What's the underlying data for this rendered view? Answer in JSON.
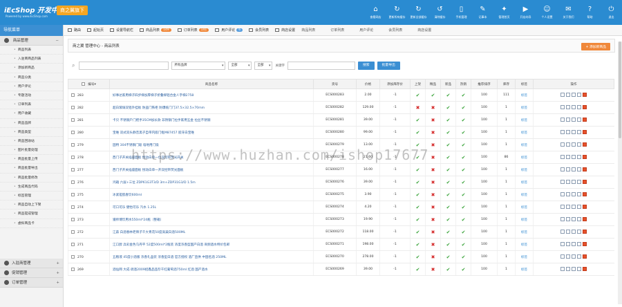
{
  "header": {
    "logo": "iEcShop 开发中心",
    "logo_sub": "Powered by www.iEcShop.com",
    "badge": "商之翼旗下",
    "nav": [
      {
        "label": "查看网店",
        "icon": "home-icon",
        "glyph": "⌂"
      },
      {
        "label": "更新所有缓存",
        "icon": "refresh-icon",
        "glyph": "↻"
      },
      {
        "label": "更新全部缓存",
        "icon": "refresh-icon",
        "glyph": "↻"
      },
      {
        "label": "清除缓存",
        "icon": "clear-icon",
        "glyph": "↺"
      },
      {
        "label": "手机管理",
        "icon": "phone-icon",
        "glyph": "▯"
      },
      {
        "label": "记事本",
        "icon": "notepad-icon",
        "glyph": "✎"
      },
      {
        "label": "管理首页",
        "icon": "manage-icon",
        "glyph": "✦"
      },
      {
        "label": "开店向导",
        "icon": "guide-icon",
        "glyph": "▶"
      },
      {
        "label": "个人设置",
        "icon": "user-icon",
        "glyph": "☺"
      },
      {
        "label": "关于我们",
        "icon": "about-icon",
        "glyph": "✉"
      },
      {
        "label": "帮助",
        "icon": "help-icon",
        "glyph": "?"
      },
      {
        "label": "退出",
        "icon": "power-icon",
        "glyph": "⏻"
      }
    ]
  },
  "sidebar": {
    "title": "导航菜单",
    "group": "商品管理",
    "items": [
      "商品列表",
      "入驻商商品列表",
      "添加新商品",
      "商品分类",
      "用户评论",
      "专题活动",
      "订单列表",
      "用户收藏",
      "商品品牌",
      "商品类型",
      "商品回收站",
      "图片批量处理",
      "商品批量上传",
      "商品批量导出",
      "商品批量修改",
      "生成商品代码",
      "标签管理",
      "商品自动上下架",
      "商品提成管理",
      "虚拟商品卡"
    ],
    "bottom_groups": [
      "入驻商管理",
      "促销管理",
      "订单管理"
    ]
  },
  "tabs": [
    {
      "label": "路由",
      "badge": ""
    },
    {
      "label": "起始页",
      "badge": ""
    },
    {
      "label": "设置导航栏",
      "badge": ""
    },
    {
      "label": "商品列表",
      "badge": "149"
    },
    {
      "label": "订单列表",
      "badge": "141"
    },
    {
      "label": "用户评论",
      "badge": "6"
    },
    {
      "label": "会员列表",
      "badge": ""
    },
    {
      "label": "商店设置",
      "badge": ""
    }
  ],
  "tabs_plain": [
    "商品列表",
    "订单列表",
    "用户评论",
    "会员列表",
    "商店设置"
  ],
  "panel": {
    "breadcrumb": "商之翼 管理中心 - 商品列表",
    "add_button": "+ 添加新商品"
  },
  "search": {
    "category": "所有品牌",
    "all1": "全部",
    "all2": "全部",
    "keyword_label": "关键字",
    "search_btn": "搜索",
    "export_btn": "批量导出"
  },
  "table": {
    "headers": [
      "编号▾",
      "商品名称",
      "货号",
      "价格",
      "添加库存价",
      "上架",
      "精品",
      "新品",
      "热销",
      "推荐排序",
      "库存",
      "标签",
      "操作"
    ],
    "rows": [
      {
        "id": "283",
        "name": "好事达家用梯子四步梯加厚梯子折叠梯铝合金人字梯2758",
        "sn": "ECS000283",
        "price": "2.00",
        "st": "-1",
        "flags": [
          "ok",
          "ok",
          "ok",
          "ok"
        ],
        "sort": "100",
        "stock": "111",
        "tag": "标签"
      },
      {
        "id": "282",
        "name": "超白玻璃双铝外挂板 防盗门铁柜 防爆纸门门37.5×32.5×70mm",
        "sn": "ECS000282",
        "price": "129.00",
        "st": "-1",
        "flags": [
          "no",
          "no",
          "ok",
          "ok"
        ],
        "sort": "100",
        "stock": "1",
        "tag": "标签"
      },
      {
        "id": "281",
        "name": "卡贝 不锈钢户门把手35CM加长款 非锈钢门拉手家用五金 拉丝不锈钢",
        "sn": "ECS000281",
        "price": "39.00",
        "st": "-1",
        "flags": [
          "ok",
          "no",
          "ok",
          "ok"
        ],
        "sort": "100",
        "stock": "1",
        "tag": "标签"
      },
      {
        "id": "280",
        "name": "宝唯 双式双头静音黑子自带内嵌门框M87457 嵌牙白宝唯",
        "sn": "ECS000280",
        "price": "99.00",
        "st": "-1",
        "flags": [
          "ok",
          "no",
          "ok",
          "ok"
        ],
        "sort": "100",
        "stock": "1",
        "tag": "标签"
      },
      {
        "id": "279",
        "name": "固特 304不锈钢门吸 墙地用门吸",
        "sn": "ECS000279",
        "price": "13.00",
        "st": "-1",
        "flags": [
          "ok",
          "no",
          "ok",
          "ok"
        ],
        "sort": "100",
        "stock": "1",
        "tag": "标签"
      },
      {
        "id": "278",
        "name": "西门子开关插座面板 悦动白单一位双控带荧光开关",
        "sn": "ECS000278",
        "price": "21.60",
        "st": "-1",
        "flags": [
          "ok",
          "no",
          "ok",
          "ok"
        ],
        "sort": "100",
        "stock": "86",
        "tag": "标签"
      },
      {
        "id": "277",
        "name": "西门子开关插座面板 悦动白单一开双控带荧光面板",
        "sn": "ECS000277",
        "price": "16.00",
        "st": "-1",
        "flags": [
          "ok",
          "no",
          "ok",
          "ok"
        ],
        "sort": "100",
        "stock": "1",
        "tag": "标签"
      },
      {
        "id": "276",
        "name": "鸿箱 六层+三位 ZDP61G3T3/D 3m+ZDP31G3/D 1.5m",
        "sn": "ECS000276",
        "price": "39.00",
        "st": "-1",
        "flags": [
          "ok",
          "no",
          "ok",
          "ok"
        ],
        "sort": "100",
        "stock": "1",
        "tag": "标签"
      },
      {
        "id": "275",
        "name": "冰紧搓肌春饮600ml",
        "sn": "ECS000275",
        "price": "3.90",
        "st": "-1",
        "flags": [
          "ok",
          "no",
          "ok",
          "ok"
        ],
        "sort": "100",
        "stock": "1",
        "tag": "标签"
      },
      {
        "id": "274",
        "name": "可口可乐 健怡可乐 汽水 1.25L",
        "sn": "ECS000274",
        "price": "4.20",
        "st": "-1",
        "flags": [
          "ok",
          "no",
          "ok",
          "ok"
        ],
        "sort": "100",
        "stock": "1",
        "tag": "标签"
      },
      {
        "id": "273",
        "name": "遵师傅饮用水550ml*24瓶（整箱）",
        "sn": "ECS000273",
        "price": "19.90",
        "st": "-1",
        "flags": [
          "ok",
          "no",
          "ok",
          "ok"
        ],
        "sort": "100",
        "stock": "1",
        "tag": "标签"
      },
      {
        "id": "272",
        "name": "江森 白酒春林老牌子千大青花50度高粱白酒500ML",
        "sn": "ECS000272",
        "price": "118.00",
        "st": "-1",
        "flags": [
          "ok",
          "no",
          "ok",
          "ok"
        ],
        "sort": "100",
        "stock": "1",
        "tag": "标签"
      },
      {
        "id": "271",
        "name": "江口醇 兵彩金色乌丹平 52度500ml*2瓶装 浓度浓香型国产白酒 商频酒水特价包邮",
        "sn": "ECS000271",
        "price": "198.00",
        "st": "-1",
        "flags": [
          "ok",
          "no",
          "ok",
          "ok"
        ],
        "sort": "100",
        "stock": "1",
        "tag": "标签"
      },
      {
        "id": "270",
        "name": "五粮液 45度小酒版 浓香礼盒装 浓香型白酒 官方授权 酒厂直供 中国名酒 250ML",
        "sn": "ECS000270",
        "price": "278.00",
        "st": "-1",
        "flags": [
          "ok",
          "no",
          "ok",
          "ok"
        ],
        "sort": "100",
        "stock": "1",
        "tag": "标签"
      },
      {
        "id": "269",
        "name": "酒仙网 大成·调酒2009招鑫品品珍干红葡萄酒750ml 红酒 国产酒水",
        "sn": "ECS000269",
        "price": "39.00",
        "st": "-1",
        "flags": [
          "ok",
          "no",
          "ok",
          "ok"
        ],
        "sort": "100",
        "stock": "1",
        "tag": "标签"
      }
    ]
  },
  "watermark": "https://www.huzhan.com/ishop17677"
}
